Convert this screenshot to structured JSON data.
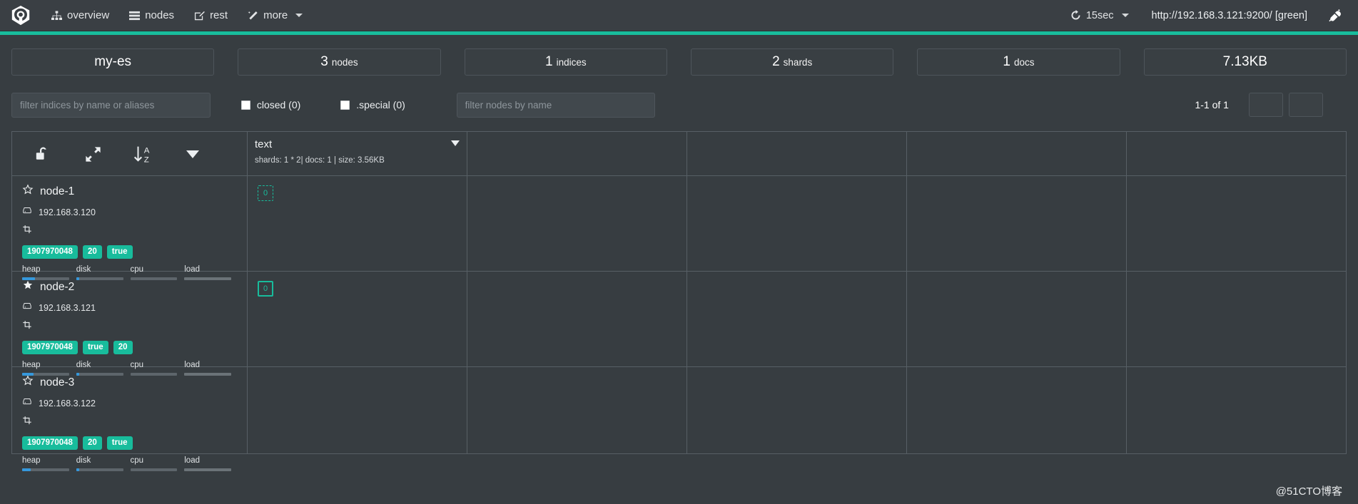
{
  "navbar": {
    "brand_icon": "cerebro-logo-icon",
    "items": [
      {
        "label": "overview",
        "icon": "sitemap-icon"
      },
      {
        "label": "nodes",
        "icon": "server-list-icon"
      },
      {
        "label": "rest",
        "icon": "edit-square-icon"
      },
      {
        "label": "more",
        "icon": "magic-wand-icon",
        "has_caret": true
      }
    ],
    "refresh": {
      "label": "15sec",
      "icon": "refresh-icon",
      "has_caret": true
    },
    "connection_url": "http://192.168.3.121:9200/ [green]",
    "disconnect_icon": "plug-icon",
    "accent_color": "#18bc9c"
  },
  "stats": [
    {
      "value": "my-es",
      "unit": "",
      "name": "cluster-name"
    },
    {
      "value": "3",
      "unit": "nodes",
      "name": "nodes-count"
    },
    {
      "value": "1",
      "unit": "indices",
      "name": "indices-count"
    },
    {
      "value": "2",
      "unit": "shards",
      "name": "shards-count"
    },
    {
      "value": "1",
      "unit": "docs",
      "name": "docs-count"
    },
    {
      "value": "7.13KB",
      "unit": "",
      "name": "storage-size"
    }
  ],
  "filters": {
    "index_filter_placeholder": "filter indices by name or aliases",
    "index_filter_value": "",
    "checkboxes": [
      {
        "label": "closed (0)",
        "checked": false,
        "name": "closed"
      },
      {
        "label": ".special (0)",
        "checked": false,
        "name": "special"
      }
    ],
    "node_filter_placeholder": "filter nodes by name",
    "node_filter_value": "",
    "pagination": {
      "label": "1-1 of 1",
      "prev_label": "",
      "next_label": ""
    }
  },
  "grid": {
    "toolbar_icons": [
      {
        "name": "unlock-icon",
        "glyph": "unlock"
      },
      {
        "name": "expand-arrows-icon",
        "glyph": "expand"
      },
      {
        "name": "sort-alpha-asc-icon",
        "glyph": "sortaz"
      },
      {
        "name": "caret-down-icon",
        "glyph": "caret"
      }
    ],
    "index_columns": [
      {
        "name": "text",
        "meta": "shards: 1 * 2| docs: 1 | size: 3.56KB",
        "caret_icon": "caret-down-icon"
      }
    ],
    "nodes": [
      {
        "name": "node-1",
        "master": false,
        "star_icon": "star-outline-icon",
        "ip": "192.168.3.120",
        "ip_icon": "hdd-icon",
        "role_icon": "crop-icon",
        "badges": [
          "1907970048",
          "20",
          "true"
        ],
        "meters": [
          {
            "label": "heap",
            "pct": 27
          },
          {
            "label": "disk",
            "pct": 6
          },
          {
            "label": "cpu",
            "pct": 0
          },
          {
            "label": "load",
            "pct": 0
          }
        ],
        "shards": [
          {
            "label": "0",
            "type": "replica"
          }
        ]
      },
      {
        "name": "node-2",
        "master": true,
        "star_icon": "star-filled-icon",
        "ip": "192.168.3.121",
        "ip_icon": "hdd-icon",
        "role_icon": "crop-icon",
        "badges": [
          "1907970048",
          "true",
          "20"
        ],
        "meters": [
          {
            "label": "heap",
            "pct": 24
          },
          {
            "label": "disk",
            "pct": 6
          },
          {
            "label": "cpu",
            "pct": 0
          },
          {
            "label": "load",
            "pct": 0
          }
        ],
        "shards": [
          {
            "label": "0",
            "type": "primary"
          }
        ]
      },
      {
        "name": "node-3",
        "master": false,
        "star_icon": "star-outline-icon",
        "ip": "192.168.3.122",
        "ip_icon": "hdd-icon",
        "role_icon": "crop-icon",
        "badges": [
          "1907970048",
          "20",
          "true"
        ],
        "meters": [
          {
            "label": "heap",
            "pct": 18
          },
          {
            "label": "disk",
            "pct": 6
          },
          {
            "label": "cpu",
            "pct": 0
          },
          {
            "label": "load",
            "pct": 0
          }
        ],
        "shards": []
      }
    ],
    "empty_columns": 4
  },
  "watermark": "@51CTO博客"
}
